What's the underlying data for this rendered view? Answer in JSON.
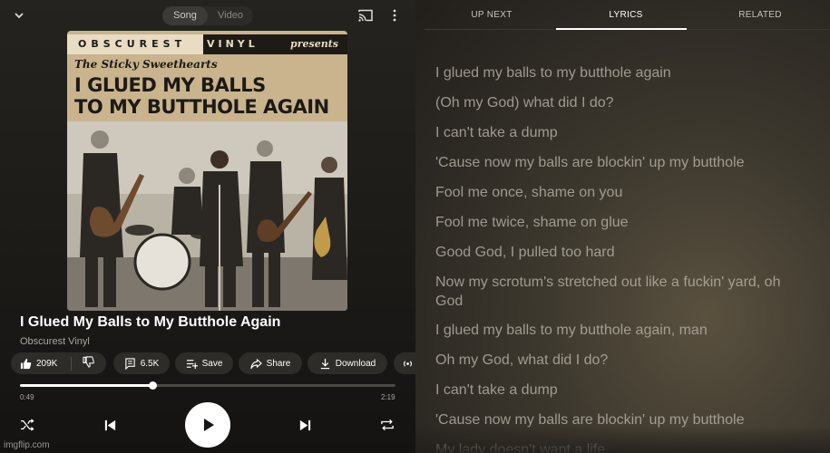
{
  "header": {
    "toggle": {
      "song": "Song",
      "video": "Video"
    }
  },
  "album_art": {
    "label_left": "OBSCUREST",
    "label_mid": "VINYL",
    "label_right": "presents",
    "artist_line": "The Sticky Sweethearts",
    "title_line1": "I GLUED MY BALLS",
    "title_line2": "TO MY BUTTHOLE AGAIN"
  },
  "track": {
    "title": "I Glued My Balls to My Butthole Again",
    "artist": "Obscurest Vinyl"
  },
  "actions": {
    "likes": "209K",
    "comments": "6.5K",
    "save": "Save",
    "share": "Share",
    "download": "Download"
  },
  "playback": {
    "current": "0:49",
    "total": "2:19",
    "progress_fraction": 0.355
  },
  "tabs": {
    "up_next": "UP NEXT",
    "lyrics": "LYRICS",
    "related": "RELATED"
  },
  "lyrics": [
    "I glued my balls to my butthole again",
    "(Oh my God) what did I do?",
    "I can't take a dump",
    "'Cause now my balls are blockin' up my butthole",
    "Fool me once, shame on you",
    "Fool me twice, shame on glue",
    "Good God, I pulled too hard",
    "Now my scrotum's stretched out like a fuckin' yard, oh God",
    "I glued my balls to my butthole again, man",
    "Oh my God, what did I do?",
    "I can't take a dump",
    "'Cause now my balls are blockin' up my butthole",
    "My lady doesn't want a life"
  ],
  "watermark": "imgflip.com"
}
